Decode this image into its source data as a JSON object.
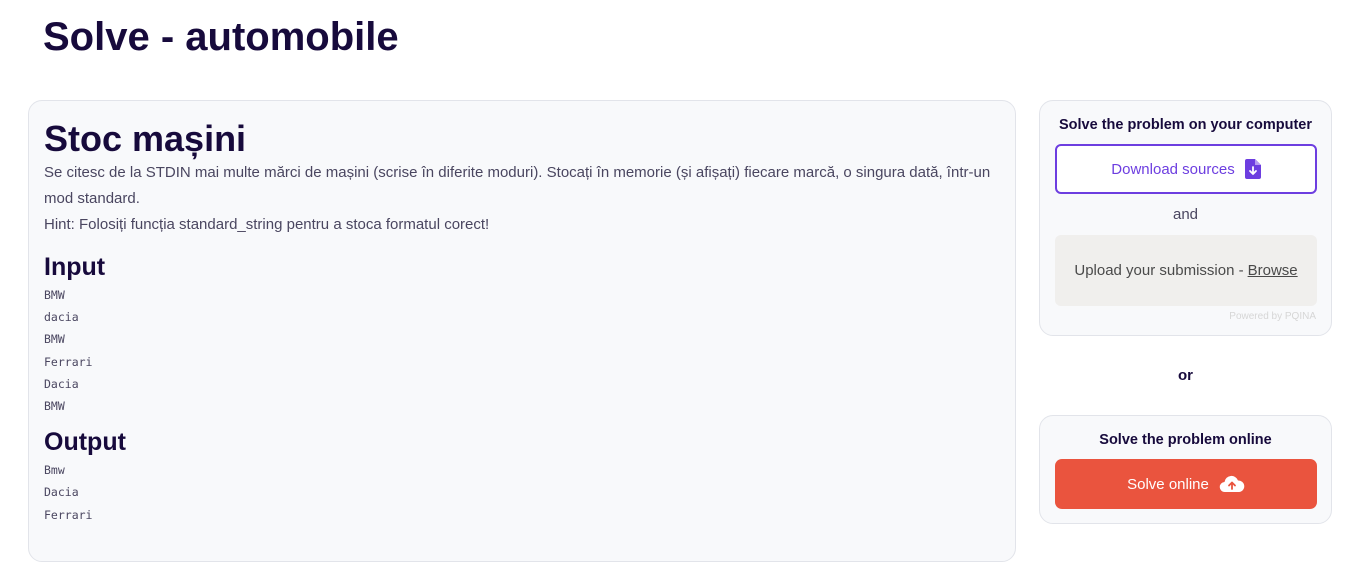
{
  "page": {
    "title": "Solve - automobile"
  },
  "problem": {
    "title": "Stoc mașini",
    "description": "Se citesc de la STDIN mai multe mărci de mașini (scrise în diferite moduri). Stocați în memorie (și afișați) fiecare marcă, o singura dată, într-un mod standard.",
    "hint": "Hint: Folosiți funcția standard_string pentru a stoca formatul corect!",
    "input_heading": "Input",
    "input_lines": [
      "BMW",
      "dacia",
      "BMW",
      "Ferrari",
      "Dacia",
      "BMW"
    ],
    "output_heading": "Output",
    "output_lines": [
      "Bmw",
      "Dacia",
      "Ferrari"
    ]
  },
  "sidebar": {
    "computer": {
      "heading": "Solve the problem on your computer",
      "download_label": "Download sources",
      "download_icon": "file-download-icon",
      "and_text": "and",
      "upload_text": "Upload your submission -",
      "browse_label": "Browse",
      "powered_by": "Powered by PQINA"
    },
    "or_text": "or",
    "online": {
      "heading": "Solve the problem online",
      "solve_label": "Solve online",
      "solve_icon": "cloud-upload-icon"
    }
  },
  "colors": {
    "title": "#170a3c",
    "accent_purple": "#6d3ee0",
    "solve_red": "#ea543e",
    "card_bg": "#f8f9fb",
    "upload_bg": "#f0efed"
  }
}
